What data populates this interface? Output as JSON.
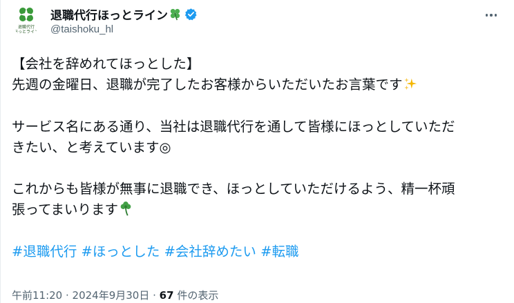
{
  "account": {
    "display_name": "退職代行ほっとライン",
    "handle": "@taishoku_hl",
    "avatar_text_line1": "退職代行",
    "avatar_text_line2": "ほっとライン"
  },
  "tweet": {
    "line1": "【会社を辞めれてほっとした】",
    "line2": "先週の金曜日、退職が完了したお客様からいただいたお言葉です",
    "line3": "サービス名にある通り、当社は退職代行を通して皆様にほっとしていただ",
    "line4": "きたい、と考えています◎",
    "line5": "これからも皆様が無事に退職でき、ほっとしていただけるよう、精一杯頑",
    "line6": "張ってまいります",
    "hashtags": [
      "#退職代行",
      "#ほっとした",
      "#会社辞めたい",
      "#転職"
    ]
  },
  "meta": {
    "time": "午前11:20",
    "separator": " · ",
    "date": "2024年9月30日",
    "views_count": "67",
    "views_label": " 件の表示"
  },
  "colors": {
    "accent": "#1d9bf0",
    "text": "#0f1419",
    "secondary": "#536471",
    "clover": "#3a9a3a"
  },
  "icons": {
    "verified": "verified-badge-icon",
    "clover": "four-leaf-clover-icon",
    "sparkles": "sparkles-icon",
    "shamrock": "shamrock-icon",
    "more": "more-options-icon"
  }
}
